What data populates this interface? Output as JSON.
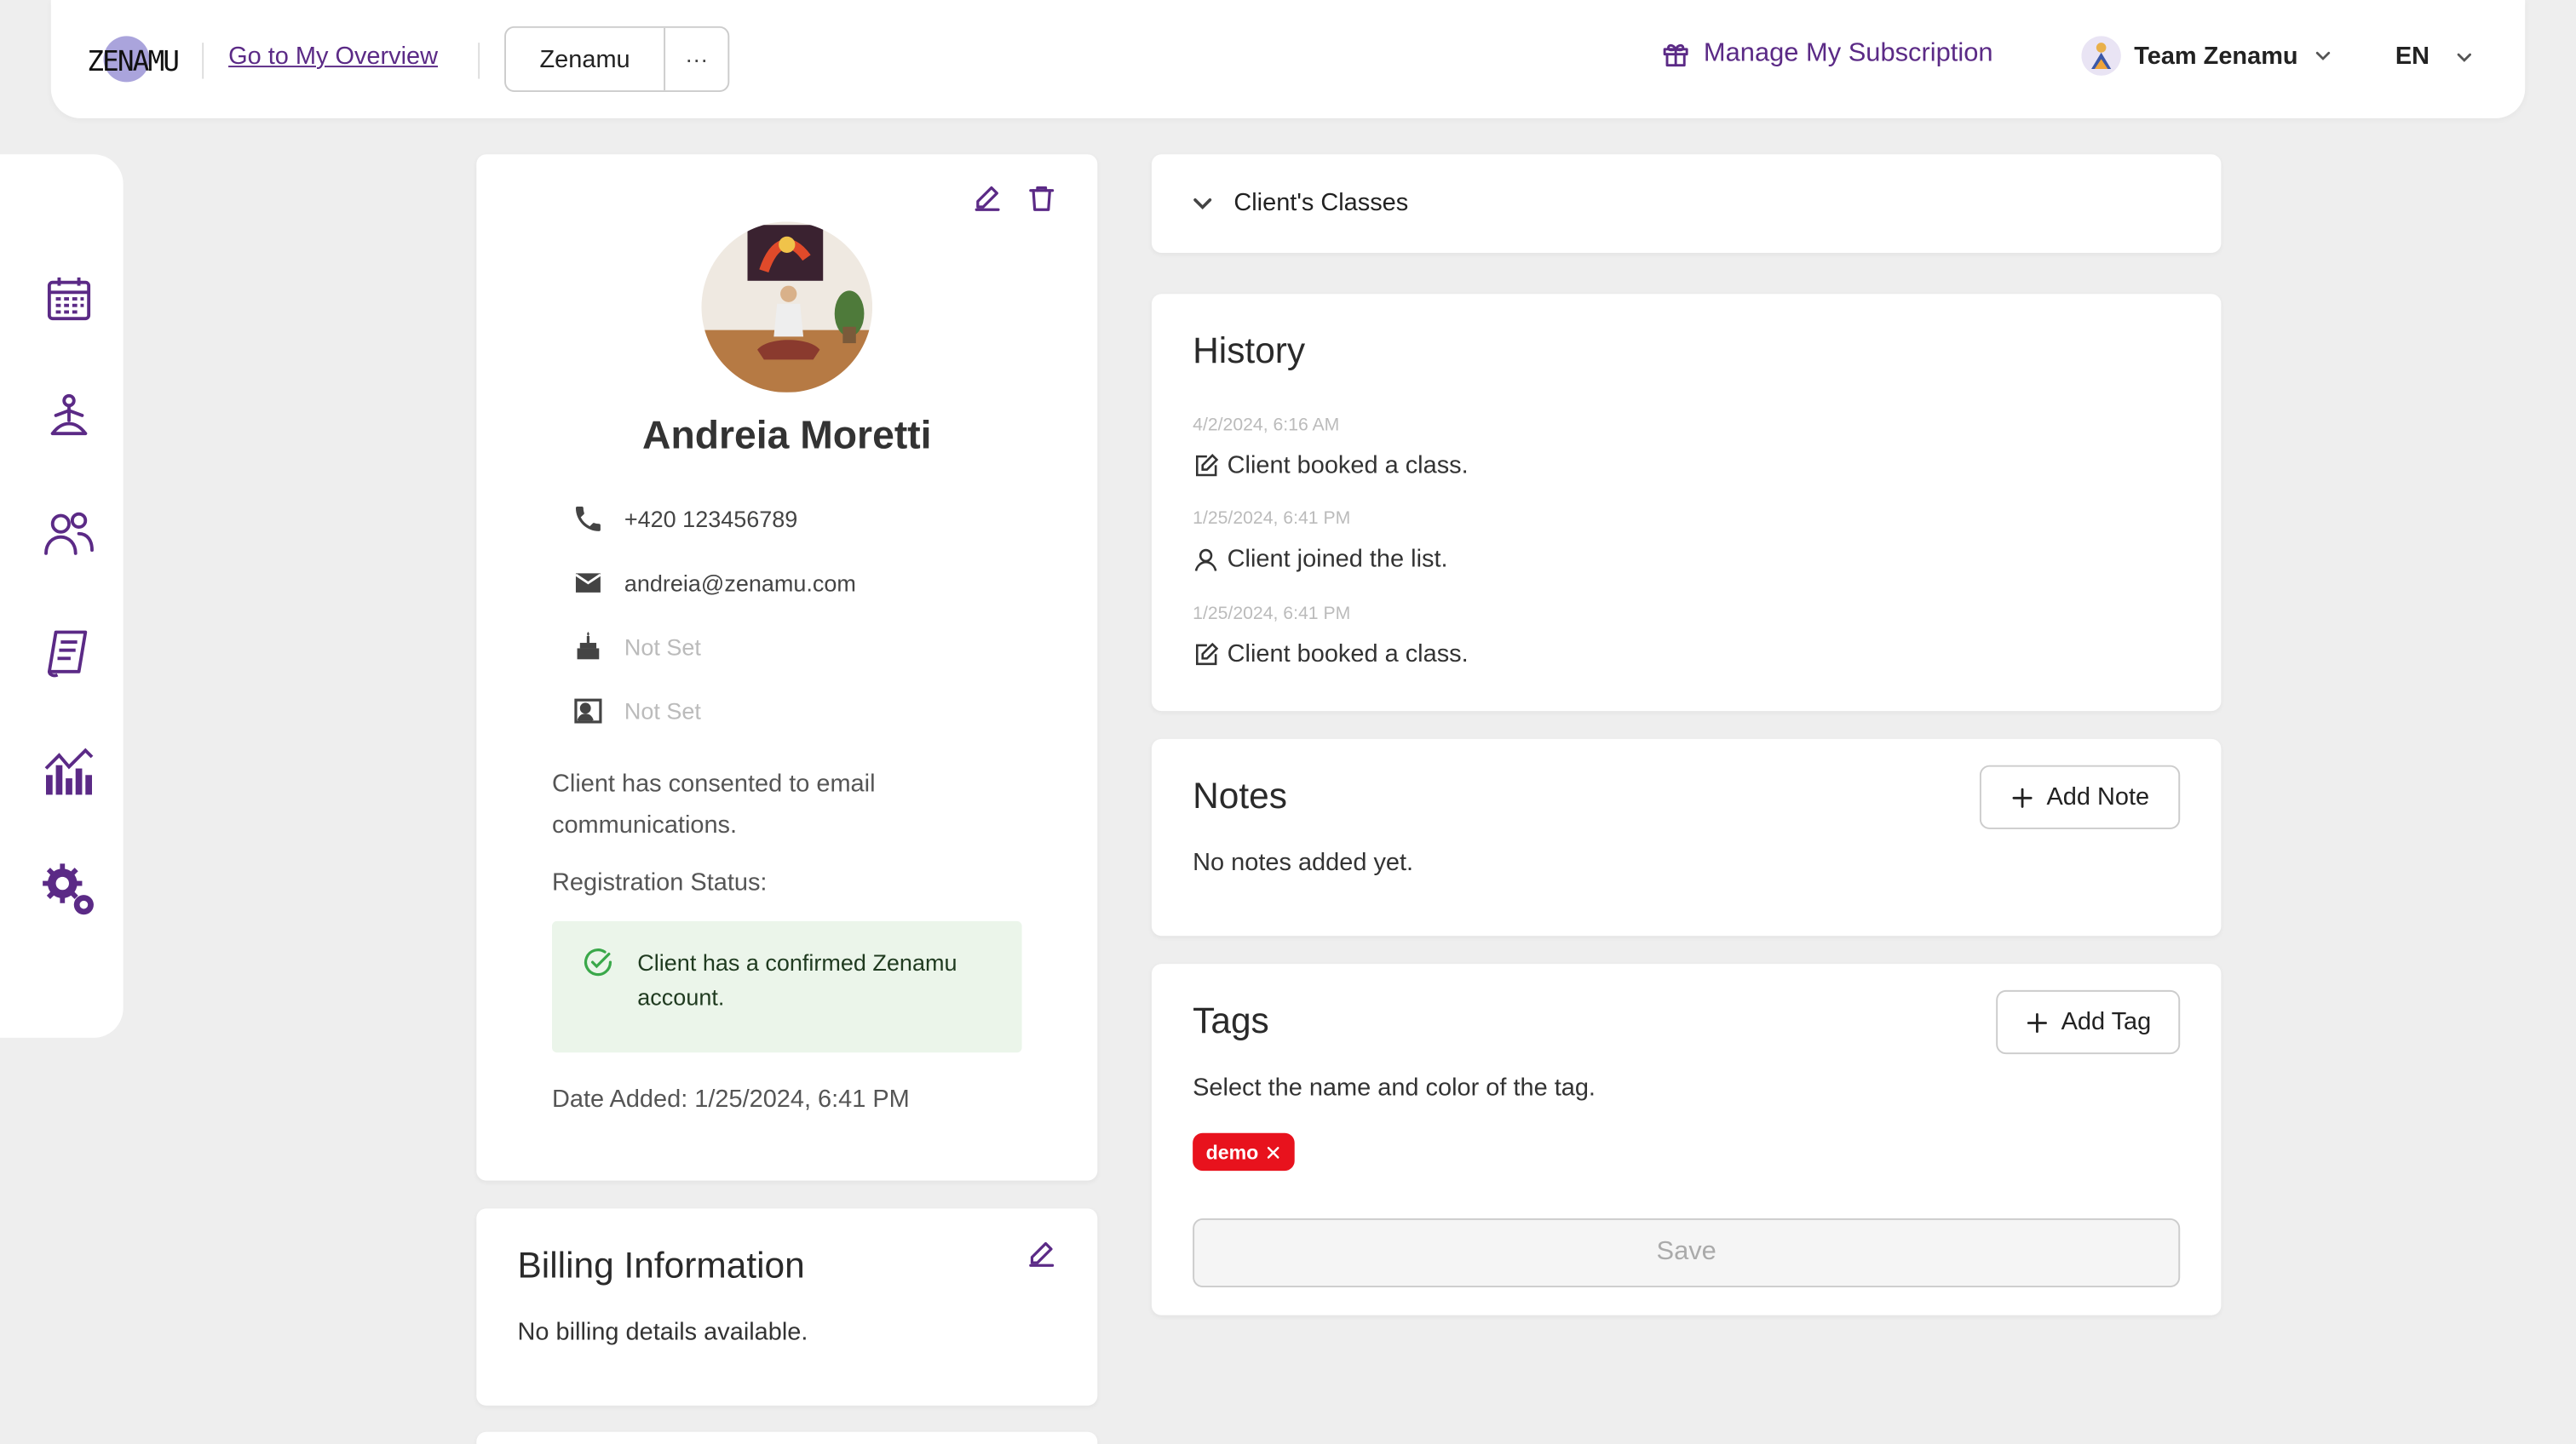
{
  "header": {
    "logo_text": "ZENAMU",
    "overview_link": "Go to My Overview",
    "studio_button": "Zenamu",
    "more_button": "···",
    "subscription_label": "Manage My Subscription",
    "team_label": "Team Zenamu",
    "language": "EN"
  },
  "colors": {
    "brand": "#5b2a86",
    "tag_red": "#e8121d",
    "status_bg": "#ebf5ea",
    "status_icon": "#3aa84a"
  },
  "sidebar": {
    "items": [
      {
        "icon": "calendar-icon"
      },
      {
        "icon": "yoga-icon"
      },
      {
        "icon": "clients-icon"
      },
      {
        "icon": "passes-icon"
      },
      {
        "icon": "statistics-icon"
      },
      {
        "icon": "settings-icon"
      }
    ]
  },
  "profile": {
    "name": "Andreia Moretti",
    "phone": "+420 123456789",
    "email": "andreia@zenamu.com",
    "birthday": "Not Set",
    "id_number": "Not Set",
    "consent_text": "Client has consented to email communications.",
    "registration_label": "Registration Status:",
    "registration_status": "Client has a confirmed Zenamu account.",
    "date_added": "Date Added: 1/25/2024, 6:41 PM"
  },
  "billing": {
    "title": "Billing Information",
    "empty_text": "No billing details available."
  },
  "classes": {
    "title": "Client's Classes"
  },
  "history": {
    "title": "History",
    "entries": [
      {
        "date": "4/2/2024, 6:16 AM",
        "text": "Client booked a class.",
        "icon": "edit-note-icon"
      },
      {
        "date": "1/25/2024, 6:41 PM",
        "text": "Client joined the list.",
        "icon": "user-icon"
      },
      {
        "date": "1/25/2024, 6:41 PM",
        "text": "Client booked a class.",
        "icon": "edit-note-icon"
      }
    ]
  },
  "notes": {
    "title": "Notes",
    "add_button": "Add Note",
    "empty_text": "No notes added yet."
  },
  "tags": {
    "title": "Tags",
    "add_button": "Add Tag",
    "hint": "Select the name and color of the tag.",
    "items": [
      {
        "label": "demo"
      }
    ],
    "save_button": "Save"
  }
}
